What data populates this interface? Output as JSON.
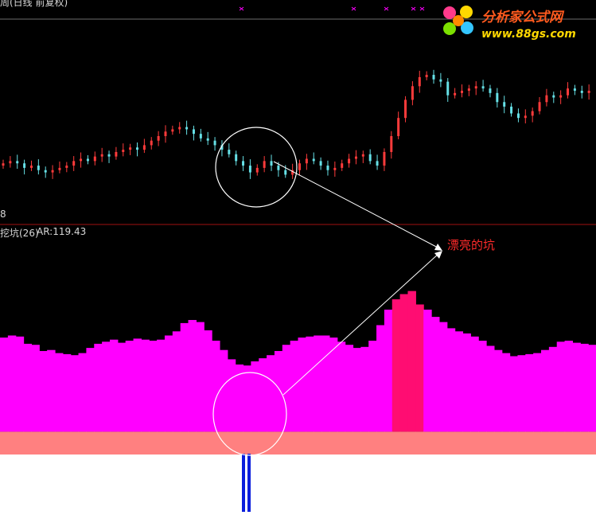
{
  "header": {
    "title": "周(日线 前复权)",
    "left_value": "8"
  },
  "indicator": {
    "name": "挖坑(26)",
    "ar_label": "AR:119.43",
    "annotation": "漂亮的坑"
  },
  "logo": {
    "name": "分析家公式网",
    "url": "www.88gs.com"
  },
  "colors": {
    "bg": "#000000",
    "up": "#ff3b3b",
    "down": "#66e0e6",
    "magenta": "#ff00ff",
    "pinkred": "#ff0d72",
    "salmon": "#ff8080",
    "white": "#ffffff",
    "signal": "#0a1edc",
    "divider": "#a01010"
  },
  "chart_data": [
    {
      "type": "candlestick",
      "series": [
        {
          "values": [
            30,
            31,
            30,
            28,
            29,
            27,
            26,
            27,
            28,
            29,
            31,
            32,
            31,
            33,
            34,
            33,
            35,
            36,
            37,
            36,
            38,
            40,
            42,
            44,
            45,
            46,
            45,
            43,
            41,
            40,
            38,
            36,
            34,
            31,
            29,
            26,
            28,
            31,
            29,
            27,
            25,
            27,
            30,
            32,
            31,
            29,
            27,
            28,
            30,
            32,
            33,
            34,
            31,
            29,
            35,
            42,
            50,
            58,
            64,
            68,
            69,
            67,
            66,
            60,
            61,
            62,
            63,
            64,
            63,
            61,
            57,
            55,
            52,
            50,
            51,
            53,
            57,
            60,
            59,
            60,
            63,
            62,
            61,
            62
          ]
        }
      ]
    },
    {
      "type": "bar",
      "series": [
        {
          "name": "AR",
          "values": [
            113,
            115,
            114,
            107,
            106,
            100,
            101,
            98,
            97,
            96,
            98,
            103,
            107,
            109,
            111,
            108,
            110,
            112,
            111,
            110,
            111,
            115,
            119,
            127,
            130,
            128,
            120,
            110,
            101,
            92,
            87,
            86,
            90,
            93,
            96,
            100,
            106,
            110,
            113,
            114,
            115,
            115,
            113,
            109,
            106,
            103,
            104,
            110,
            125,
            140,
            150,
            155,
            158,
            145,
            140,
            133,
            128,
            122,
            119,
            117,
            114,
            110,
            105,
            101,
            98,
            95,
            96,
            97,
            98,
            101,
            104,
            109,
            110,
            108,
            107,
            106
          ]
        }
      ],
      "threshold": 100
    }
  ]
}
